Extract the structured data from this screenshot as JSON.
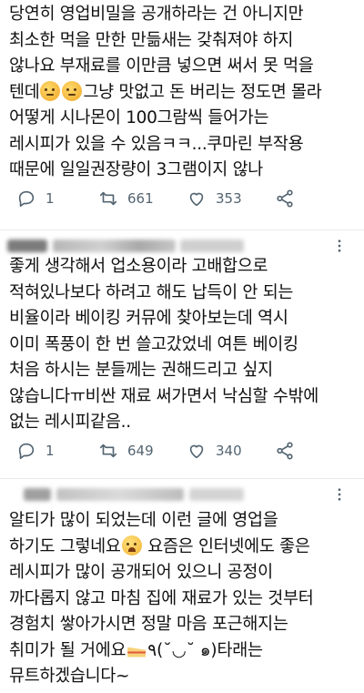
{
  "tweets": [
    {
      "lines": [
        "당연히 영업비밀을 공개하라는 건 아니지만",
        "최소한 먹을 만한 만듦새는 갖춰져야 하지",
        "않나요 부재료를 이만큼 넣으면 써서 못 먹을",
        "텐데",
        "그냥 맛없고 돈 버리는 정도면 몰라",
        "어떻게 시나몬이 100그람씩 들어가는",
        "레시피가 있을 수 있음ㅋㅋ...쿠마린 부작용",
        "때문에 일일권장량이 3그램이지 않나"
      ],
      "emoji": "thinking-face-emoji",
      "replies": "1",
      "retweets": "661",
      "likes": "353"
    },
    {
      "lines": [
        "좋게 생각해서 업소용이라 고배합으로",
        "적혀있나보다 하려고 해도 납득이 안 되는",
        "비율이라 베이킹 커뮤에 찾아보는데 역시",
        "이미 폭풍이 한 번 쓸고갔었네 여튼 베이킹",
        "처음 하시는 분들께는 권해드리고 싶지",
        "않습니다ㅠ비싼 재료 써가면서 낙심할 수밖에",
        "없는 레시피같음.."
      ],
      "replies": "1",
      "retweets": "649",
      "likes": "340"
    },
    {
      "lines": [
        "알티가 많이 되었는데 이런 글에 영업을",
        "하기도 그렇네요",
        "요즘은 인터넷에도 좋은",
        "레시피가 많이 공개되어 있으니 공정이",
        "까다롭지 않고 마침 집에 재료가 있는 것부터",
        "경험치 쌓아가시면 정말 마음 포근해지는",
        "취미가 될 거에요",
        "٩(˘◡˘ ๑)타래는",
        "뮤트하겠습니다~"
      ]
    }
  ],
  "icons": {
    "reply": "reply-icon",
    "retweet": "retweet-icon",
    "like": "like-icon",
    "share": "share-icon",
    "more": "more-options-icon"
  }
}
